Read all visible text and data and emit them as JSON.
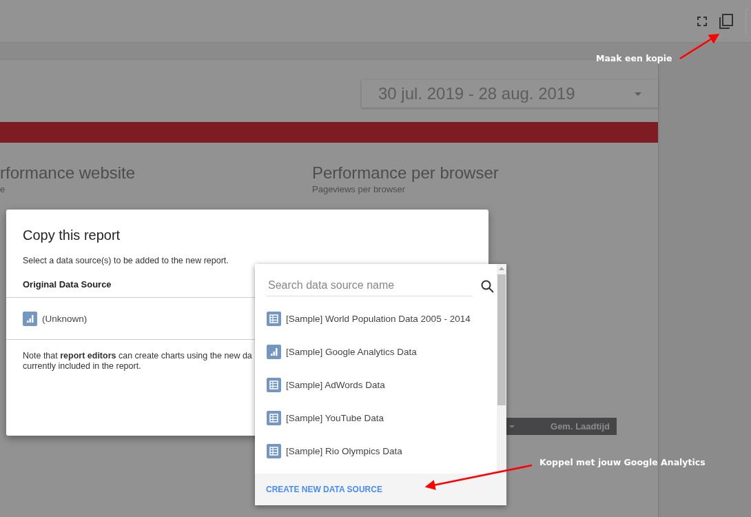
{
  "report": {
    "date_range": "30 jul. 2019 - 28 aug. 2019",
    "sections": [
      {
        "title": "rformance website",
        "subtitle": "e"
      },
      {
        "title": "Performance per browser",
        "subtitle": "Pageviews per browser"
      }
    ],
    "table_header": "Gem. Laadtijd"
  },
  "dialog": {
    "title": "Copy this report",
    "description": "Select a data source(s) to be added to the new report.",
    "column_header": "Original Data Source",
    "source": {
      "name": "(Unknown)",
      "kind": "analytics"
    },
    "note": [
      "Note that **report editors** can create charts using the new da",
      "currently included in the report."
    ]
  },
  "dropdown": {
    "search_placeholder": "Search data source name",
    "items": [
      {
        "name": "[Sample] World Population Data 2005 - 2014",
        "kind": "table"
      },
      {
        "name": "[Sample] Google Analytics Data",
        "kind": "analytics"
      },
      {
        "name": "[Sample] AdWords Data",
        "kind": "table"
      },
      {
        "name": "[Sample] YouTube Data",
        "kind": "table"
      },
      {
        "name": "[Sample] Rio Olympics Data",
        "kind": "table"
      }
    ],
    "create_button": "CREATE NEW DATA SOURCE"
  },
  "annotations": [
    {
      "text": "Maak een kopie"
    },
    {
      "text": "Koppel met jouw Google Analytics"
    }
  ]
}
